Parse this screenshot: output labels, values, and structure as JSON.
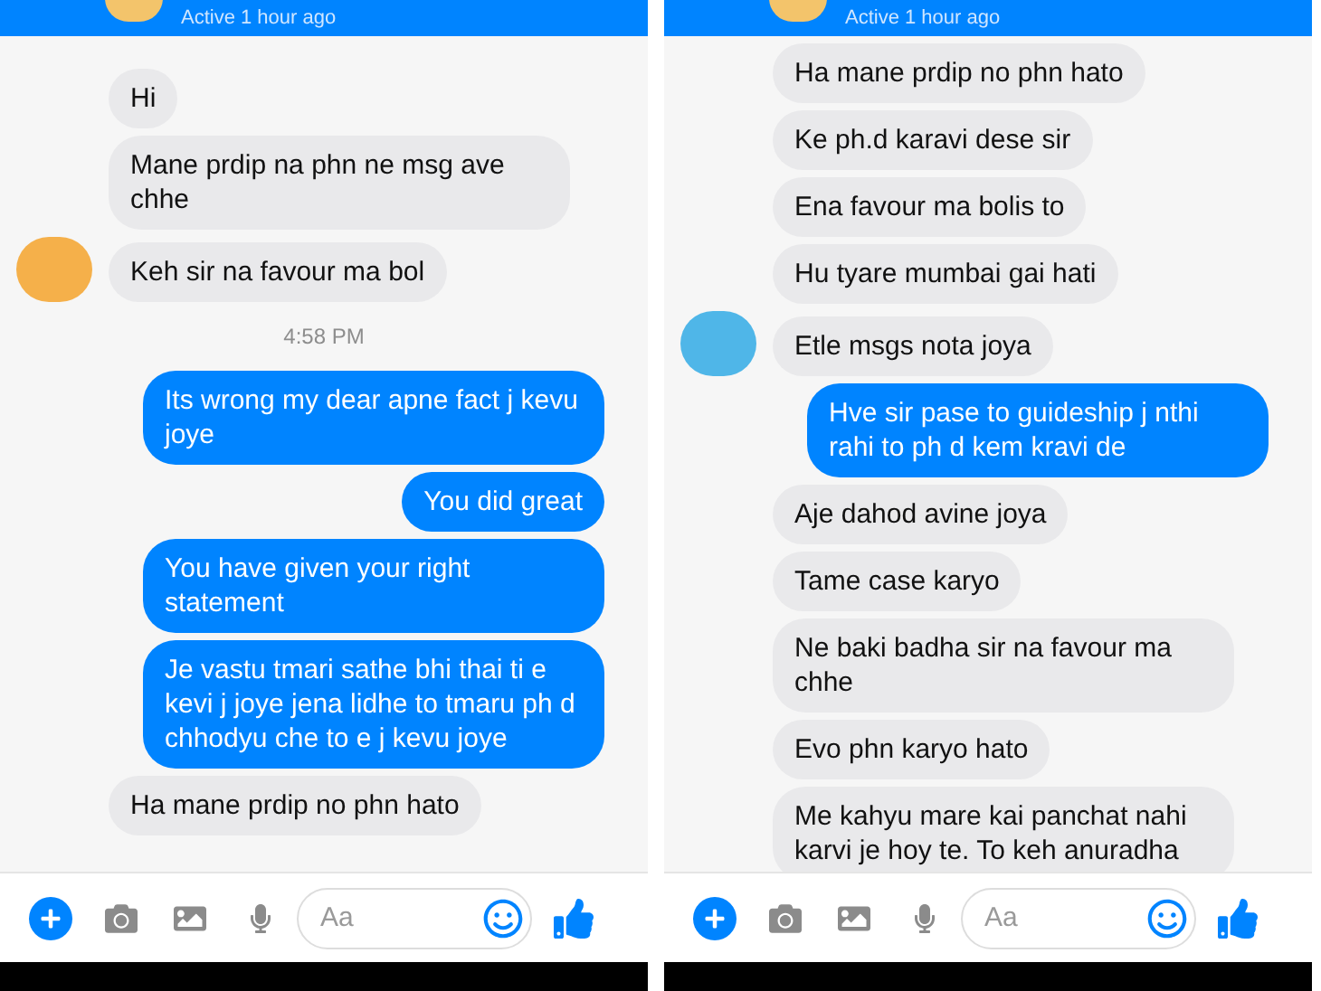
{
  "panels": [
    {
      "header": {
        "status": "Active 1 hour ago"
      },
      "messages": [
        {
          "kind": "received",
          "text": "Hi",
          "avatar": false
        },
        {
          "kind": "received",
          "text": "Mane prdip na phn ne msg ave chhe",
          "avatar": false
        },
        {
          "kind": "received",
          "text": "Keh sir na favour ma bol",
          "avatar": true
        },
        {
          "kind": "time",
          "text": "4:58 PM"
        },
        {
          "kind": "sent",
          "text": "Its wrong my dear apne fact j kevu joye"
        },
        {
          "kind": "sent",
          "text": "You did great"
        },
        {
          "kind": "sent",
          "text": "You have given your right statement"
        },
        {
          "kind": "sent",
          "text": "Je vastu tmari sathe bhi thai ti e kevi j joye jena lidhe to tmaru ph d chhodyu che to e j kevu joye"
        },
        {
          "kind": "received",
          "text": "Ha mane prdip no phn hato",
          "avatar": false
        }
      ],
      "composer": {
        "placeholder": "Aa"
      }
    },
    {
      "header": {
        "status": "Active 1 hour ago"
      },
      "messages": [
        {
          "kind": "received",
          "text": "Ha mane prdip no phn hato",
          "avatar": false
        },
        {
          "kind": "received",
          "text": "Ke ph.d karavi dese sir",
          "avatar": false
        },
        {
          "kind": "received",
          "text": "Ena favour ma bolis to",
          "avatar": false
        },
        {
          "kind": "received",
          "text": "Hu tyare mumbai gai hati",
          "avatar": false
        },
        {
          "kind": "received",
          "text": "Etle msgs nota joya",
          "avatar": true
        },
        {
          "kind": "sent",
          "text": "Hve sir pase to guideship j nthi rahi to ph d kem kravi de"
        },
        {
          "kind": "received",
          "text": "Aje dahod avine joya",
          "avatar": false
        },
        {
          "kind": "received",
          "text": "Tame case karyo",
          "avatar": false
        },
        {
          "kind": "received",
          "text": "Ne baki badha sir na favour ma chhe",
          "avatar": false
        },
        {
          "kind": "received",
          "text": "Evo phn karyo hato",
          "avatar": false
        },
        {
          "kind": "received",
          "text": "Me kahyu mare kai panchat nahi karvi je hoy te. To keh anuradha",
          "avatar": false
        }
      ],
      "composer": {
        "placeholder": "Aa"
      }
    }
  ]
}
